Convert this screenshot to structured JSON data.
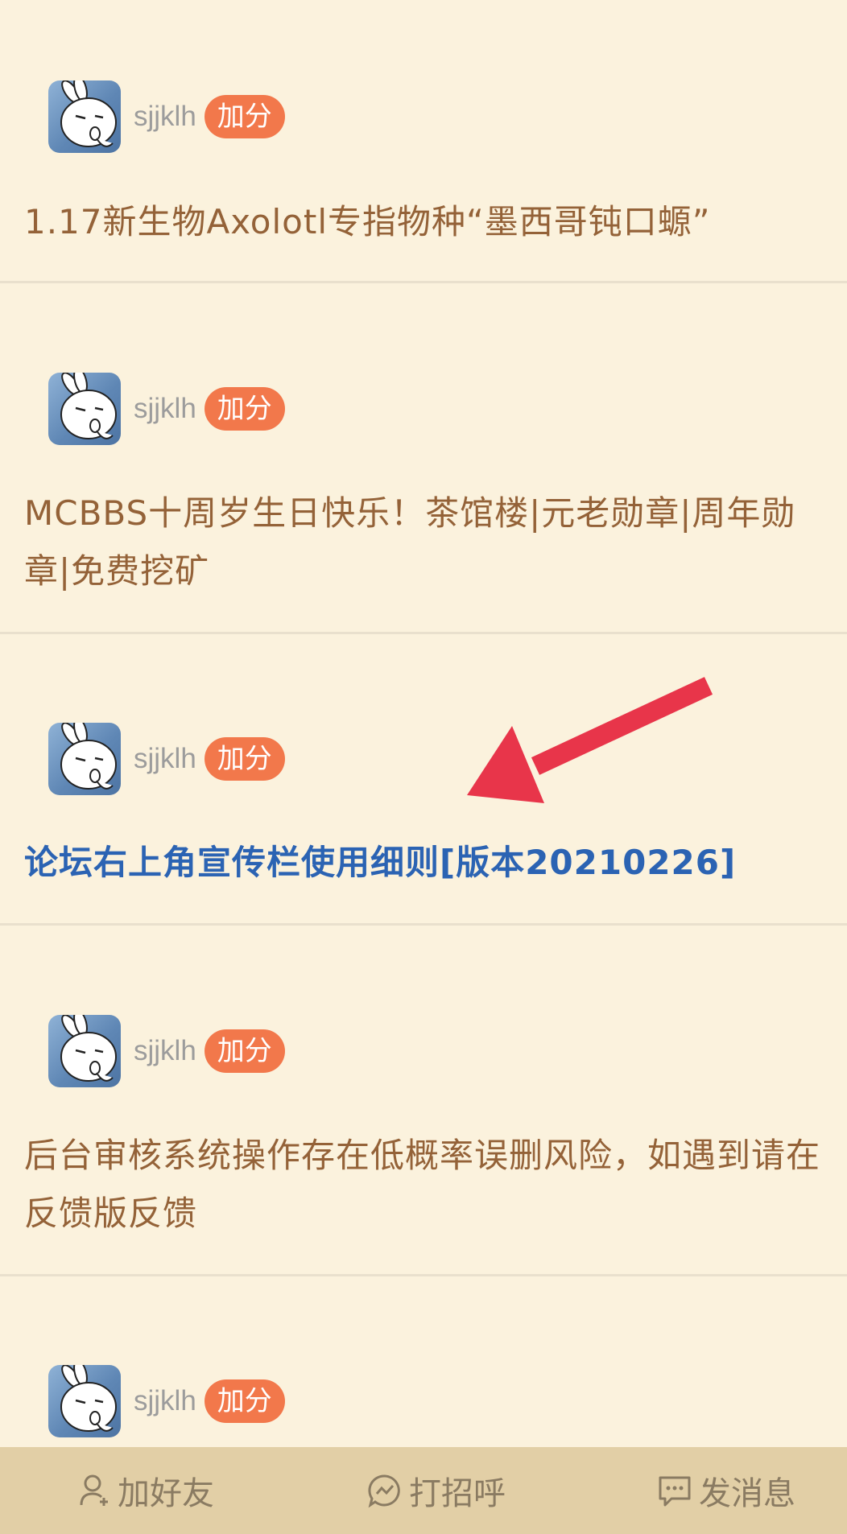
{
  "posts": [
    {
      "username": "sjjklh",
      "badge": "加分",
      "title": "1.17新生物Axolotl专指物种“墨西哥钝口螈”"
    },
    {
      "username": "sjjklh",
      "badge": "加分",
      "title": "MCBBS十周岁生日快乐！茶馆楼|元老勋章|周年勋章|免费挖矿"
    },
    {
      "username": "sjjklh",
      "badge": "加分",
      "title": "论坛右上角宣传栏使用细则[版本20210226]"
    },
    {
      "username": "sjjklh",
      "badge": "加分",
      "title": "后台审核系统操作存在低概率误删风险，如遇到请在反馈版反馈"
    },
    {
      "username": "sjjklh",
      "badge": "加分",
      "title": ""
    }
  ],
  "bottom_bar": {
    "add_friend": "加好友",
    "greet": "打招呼",
    "send_message": "发消息"
  },
  "colors": {
    "background": "#fbf2dd",
    "title": "#946238",
    "link_title": "#2b63b3",
    "badge": "#f2784b",
    "arrow": "#e8354a",
    "bottom_bar": "#e2cfa6"
  },
  "icons": {
    "add_friend": "person-plus-icon",
    "greet": "chat-wave-icon",
    "send_message": "message-icon",
    "annotation": "red-arrow"
  }
}
